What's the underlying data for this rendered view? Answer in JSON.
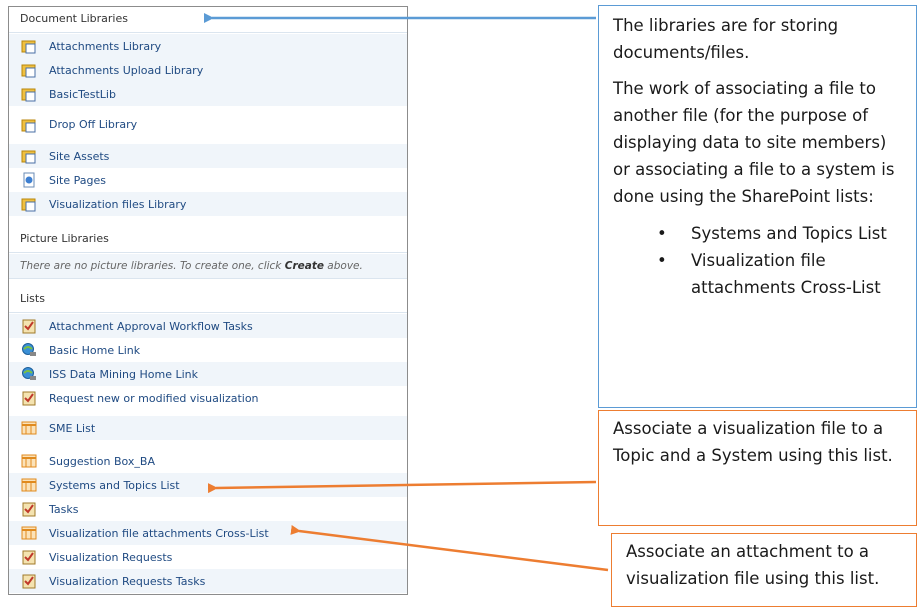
{
  "panel": {
    "document_libraries_header": "Document Libraries",
    "document_libraries": [
      {
        "label": "Attachments Library",
        "icon": "folder-doc-icon"
      },
      {
        "label": "Attachments Upload Library",
        "icon": "folder-doc-icon"
      },
      {
        "label": "BasicTestLib",
        "icon": "folder-doc-icon"
      },
      {
        "label": "Drop Off Library",
        "icon": "folder-doc-icon"
      },
      {
        "label": "Site Assets",
        "icon": "folder-doc-icon"
      },
      {
        "label": "Site Pages",
        "icon": "page-icon"
      },
      {
        "label": "Visualization files Library",
        "icon": "folder-doc-icon"
      }
    ],
    "picture_libraries_header": "Picture Libraries",
    "picture_libraries_empty_prefix": "There are no picture libraries. To create one, click ",
    "picture_libraries_empty_link": "Create",
    "picture_libraries_empty_suffix": " above.",
    "lists_header": "Lists",
    "lists": [
      {
        "label": "Attachment Approval Workflow Tasks",
        "icon": "task-list-icon"
      },
      {
        "label": "Basic Home Link",
        "icon": "link-globe-icon"
      },
      {
        "label": "ISS Data Mining Home Link",
        "icon": "link-globe-icon"
      },
      {
        "label": "Request new or modified visualization",
        "icon": "task-list-icon"
      },
      {
        "label": "SME List",
        "icon": "grid-list-icon"
      },
      {
        "label": "Suggestion Box_BA",
        "icon": "grid-list-icon"
      },
      {
        "label": "Systems and Topics List",
        "icon": "grid-list-icon"
      },
      {
        "label": "Tasks",
        "icon": "task-list-icon"
      },
      {
        "label": "Visualization file attachments Cross-List",
        "icon": "grid-list-icon"
      },
      {
        "label": "Visualization Requests",
        "icon": "task-list-icon"
      },
      {
        "label": "Visualization Requests Tasks",
        "icon": "task-list-icon"
      }
    ]
  },
  "callouts": {
    "blue": {
      "para1": "The libraries are for storing documents/files.",
      "para2": "The work of associating a file to another file (for the purpose of displaying data to site members) or associating a file to a system is done using the SharePoint lists:",
      "bullets": [
        "Systems and Topics List",
        "Visualization file attachments Cross-List"
      ]
    },
    "orange1": "Associate a visualization file to a Topic and a System using this list.",
    "orange2": "Associate an attachment to a visualization file using this list."
  },
  "colors": {
    "blue_accent": "#5b9bd5",
    "orange_accent": "#ed7d31",
    "link_text": "#1f4a82"
  }
}
